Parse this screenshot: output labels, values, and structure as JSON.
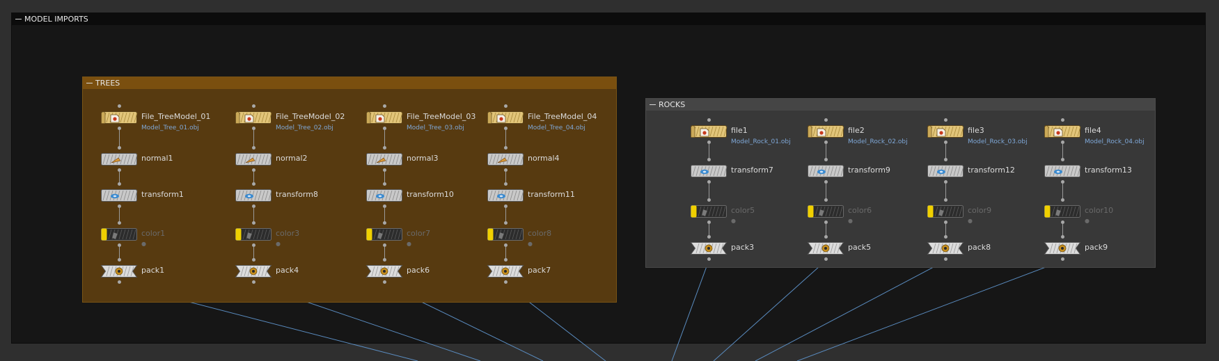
{
  "network_boxes": {
    "model_imports": {
      "title": "MODEL IMPORTS"
    },
    "trees": {
      "title": "TREES"
    },
    "rocks": {
      "title": "ROCKS"
    }
  },
  "colors": {
    "file_node": "#e2c57a",
    "op_node": "#c9c9c9",
    "pack_node": "#dcdcdc",
    "bypass_flag": "#f0d000",
    "wire": "#5a8cc0",
    "trees_box": "#573a10",
    "rocks_box": "#383838"
  },
  "trees": {
    "columns": [
      {
        "file": "File_TreeModel_01",
        "filepath": "Model_Tree_01.obj",
        "normal": "normal1",
        "transform": "transform1",
        "color": "color1",
        "pack": "pack1"
      },
      {
        "file": "File_TreeModel_02",
        "filepath": "Model_Tree_02.obj",
        "normal": "normal2",
        "transform": "transform8",
        "color": "color3",
        "pack": "pack4"
      },
      {
        "file": "File_TreeModel_03",
        "filepath": "Model_Tree_03.obj",
        "normal": "normal3",
        "transform": "transform10",
        "color": "color7",
        "pack": "pack6"
      },
      {
        "file": "File_TreeModel_04",
        "filepath": "Model_Tree_04.obj",
        "normal": "normal4",
        "transform": "transform11",
        "color": "color8",
        "pack": "pack7"
      }
    ]
  },
  "rocks": {
    "columns": [
      {
        "file": "file1",
        "filepath": "Model_Rock_01.obj",
        "transform": "transform7",
        "color": "color5",
        "pack": "pack3"
      },
      {
        "file": "file2",
        "filepath": "Model_Rock_02.obj",
        "transform": "transform9",
        "color": "color6",
        "pack": "pack5"
      },
      {
        "file": "file3",
        "filepath": "Model_Rock_03.obj",
        "transform": "transform12",
        "color": "color9",
        "pack": "pack8"
      },
      {
        "file": "file4",
        "filepath": "Model_Rock_04.obj",
        "transform": "transform13",
        "color": "color10",
        "pack": "pack9"
      }
    ]
  }
}
